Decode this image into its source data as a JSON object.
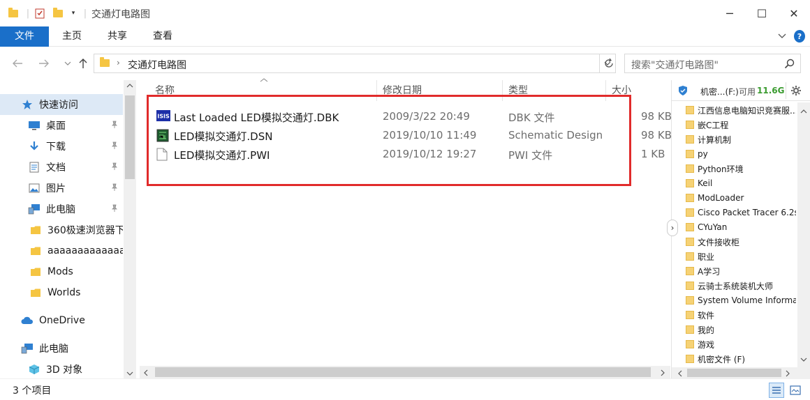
{
  "window": {
    "title": "交通灯电路图",
    "minimize": "─",
    "maximize": "☐",
    "close": "✕"
  },
  "ribbon": {
    "tabs": [
      "文件",
      "主页",
      "共享",
      "查看"
    ],
    "expand_icon": "chevron-down-icon",
    "help": "?"
  },
  "address": {
    "path": "交通灯电路图",
    "search_placeholder": "搜索\"交通灯电路图\""
  },
  "nav": {
    "items": [
      {
        "label": "快速访问",
        "icon": "star-icon",
        "selected": true
      },
      {
        "label": "桌面",
        "icon": "desktop-icon",
        "pinned": true
      },
      {
        "label": "下载",
        "icon": "download-icon",
        "pinned": true
      },
      {
        "label": "文档",
        "icon": "document-icon",
        "pinned": true
      },
      {
        "label": "图片",
        "icon": "picture-icon",
        "pinned": true
      },
      {
        "label": "此电脑",
        "icon": "computer-icon",
        "pinned": true
      },
      {
        "label": "360极速浏览器下",
        "icon": "folder-icon"
      },
      {
        "label": "aaaaaaaaaaaaaaaa",
        "icon": "folder-icon"
      },
      {
        "label": "Mods",
        "icon": "folder-icon"
      },
      {
        "label": "Worlds",
        "icon": "folder-icon"
      },
      {
        "label": "OneDrive",
        "icon": "cloud-icon"
      },
      {
        "label": "此电脑",
        "icon": "computer-icon"
      },
      {
        "label": "3D 对象",
        "icon": "cube-icon"
      }
    ]
  },
  "list": {
    "columns": [
      "名称",
      "修改日期",
      "类型",
      "大小"
    ],
    "files": [
      {
        "name": "Last Loaded LED模拟交通灯.DBK",
        "date": "2009/3/22 20:49",
        "type": "DBK 文件",
        "size": "98 KB",
        "icon": "isis-icon"
      },
      {
        "name": "LED模拟交通灯.DSN",
        "date": "2019/10/10 11:49",
        "type": "Schematic Design",
        "size": "98 KB",
        "icon": "schematic-icon"
      },
      {
        "name": "LED模拟交通灯.PWI",
        "date": "2019/10/12 19:27",
        "type": "PWI 文件",
        "size": "1 KB",
        "icon": "file-icon"
      }
    ]
  },
  "side": {
    "drive": "机密...(F:)",
    "free_label": "可用",
    "free_value": "11.6G",
    "accent": "#3a9b2f",
    "items": [
      "江西信息电脑知识竞赛服...",
      "嵌C工程",
      "计算机制",
      "py",
      "Python环境",
      "Keil",
      "ModLoader",
      "Cisco Packet Tracer 6.2s",
      "CYuYan",
      "文件接收柜",
      "职业",
      "A学习",
      "云骑士系统装机大师",
      "System Volume Informa",
      "软件",
      "我的",
      "游戏",
      "机密文件 (F)"
    ]
  },
  "status": {
    "text": "3 个项目"
  }
}
